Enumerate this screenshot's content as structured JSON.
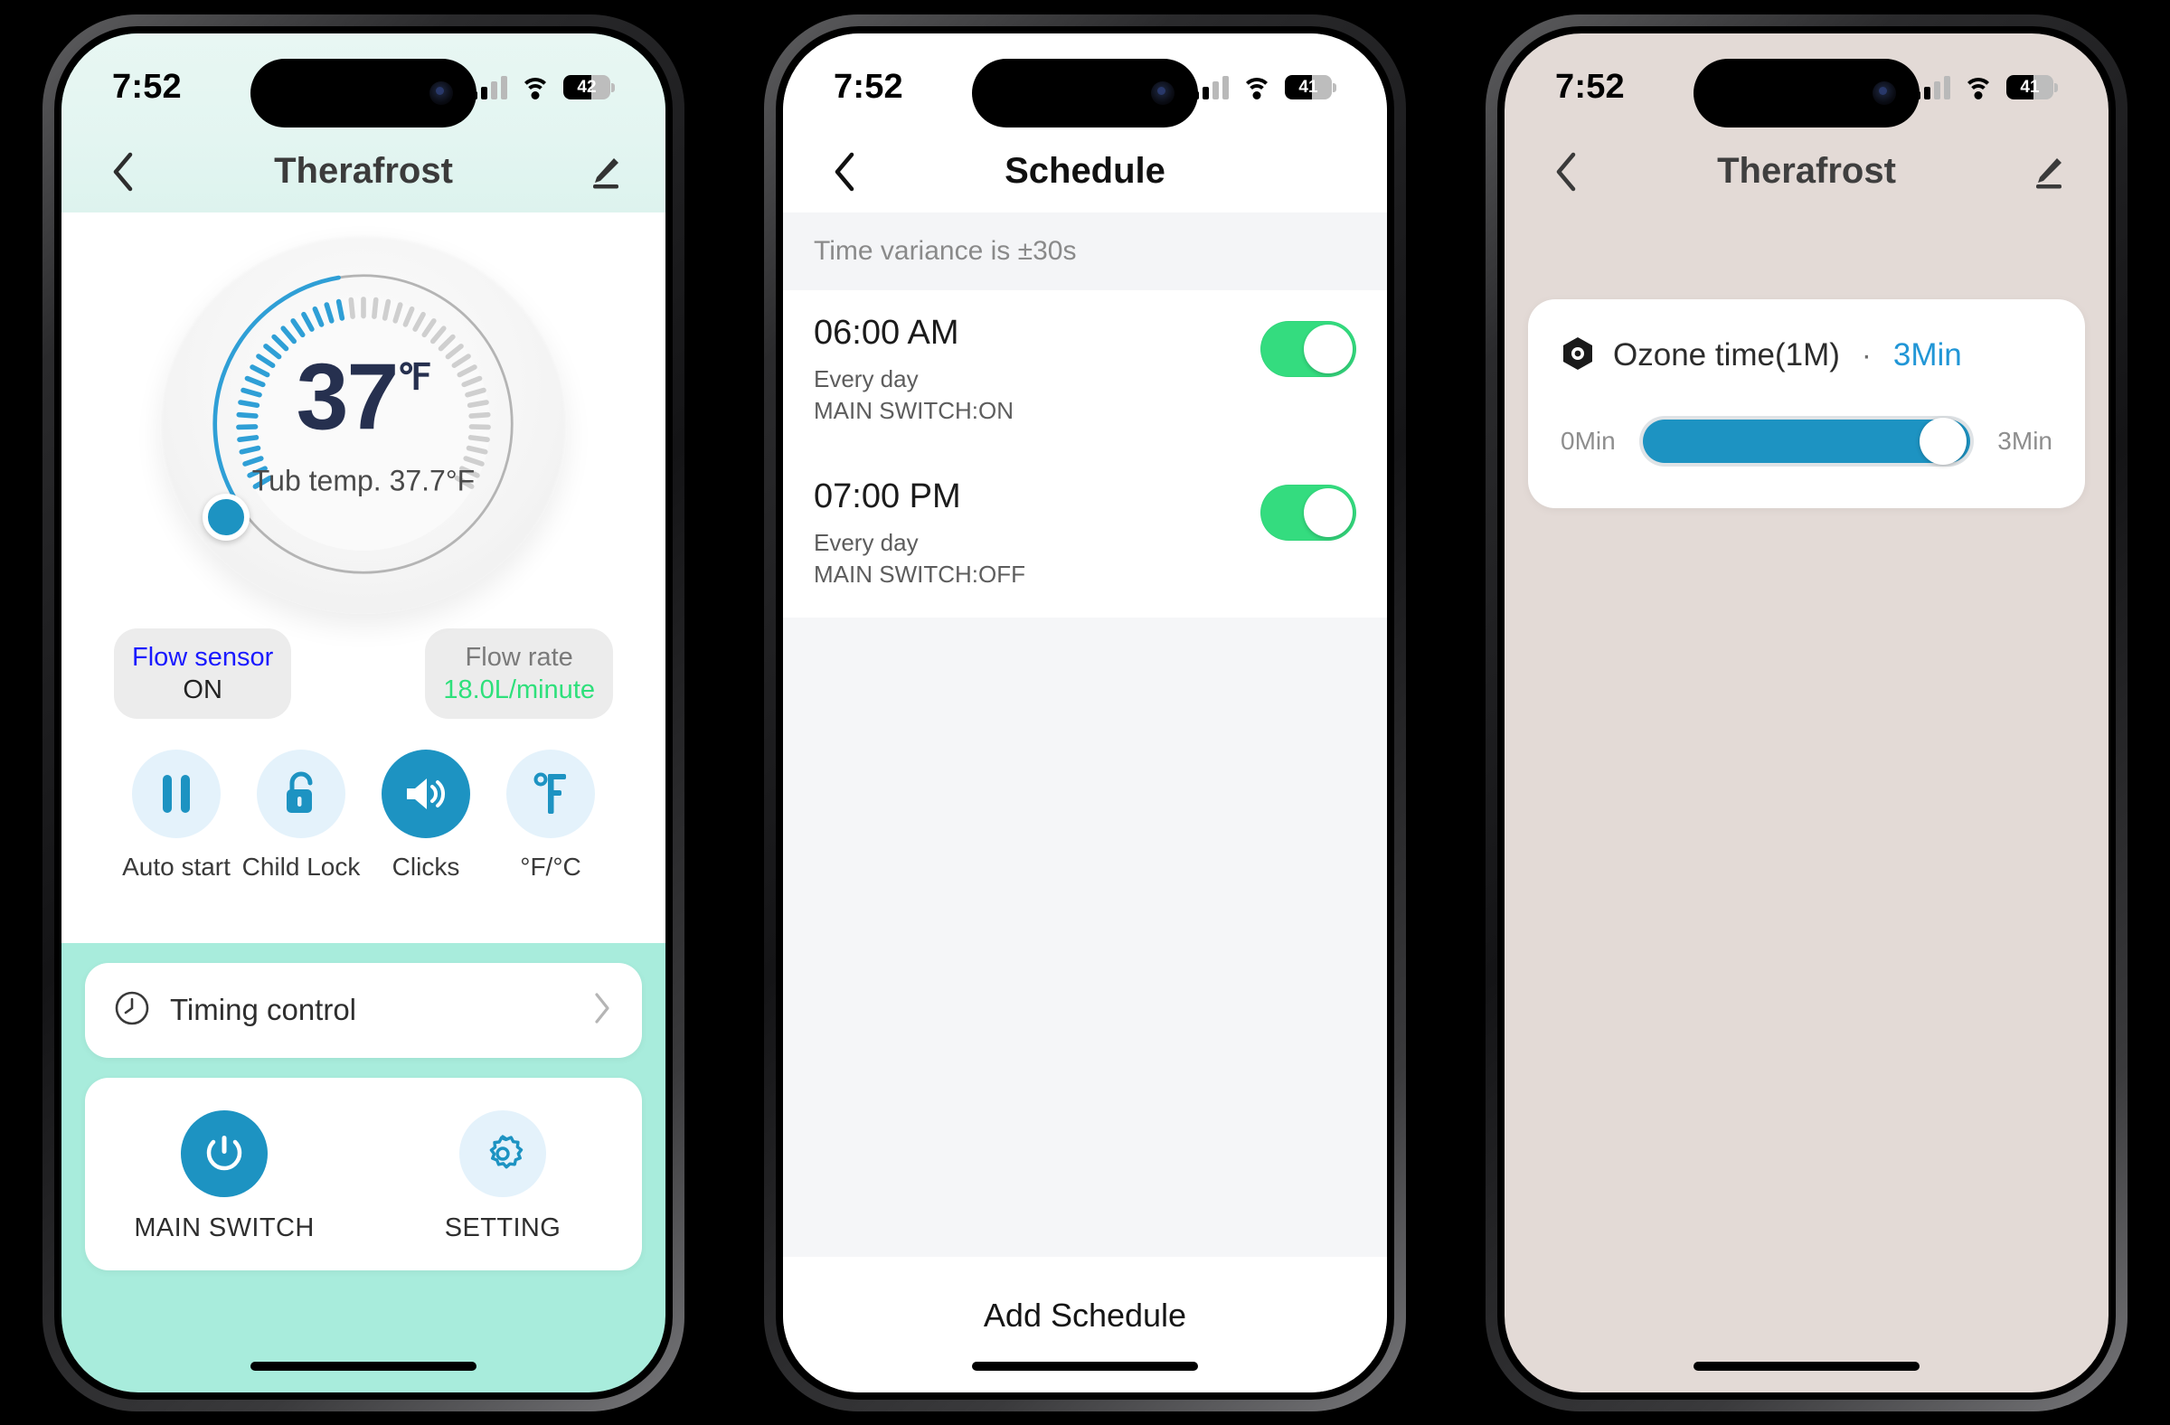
{
  "phones": [
    {
      "id": "home",
      "status": {
        "time": "7:52",
        "battery": "42",
        "battery_pct": 60,
        "signal_icon": "cellular-bars-icon",
        "wifi_icon": "wifi-icon",
        "battery_icon": "battery-icon"
      },
      "nav": {
        "back_icon": "chevron-left-icon",
        "title": "Therafrost",
        "edit_icon": "pencil-edit-icon"
      },
      "dial": {
        "temp": "37",
        "unit": "℉",
        "subtitle": "Tub temp. 37.7°F",
        "handle_icon": "dial-handle",
        "arc_color": "#2f9fd6",
        "value_color": "#26304f"
      },
      "chips": [
        {
          "name": "flow-sensor",
          "line1": "Flow sensor",
          "line2": "ON",
          "line1_color": "#1a1aff",
          "line2_color": "#222222"
        },
        {
          "name": "flow-rate",
          "line1": "Flow rate",
          "line2": "18.0L/minute",
          "line1_color": "#7a7a7a",
          "line2_color": "#2ee07b"
        }
      ],
      "icons": [
        {
          "label": "Auto start",
          "icon": "pause-icon",
          "active": false
        },
        {
          "label": "Child Lock",
          "icon": "unlocked-padlock-icon",
          "active": false
        },
        {
          "label": "Clicks",
          "icon": "speaker-volume-icon",
          "active": true
        },
        {
          "label": "°F/°C",
          "icon": "fahrenheit-icon",
          "active": false
        }
      ],
      "timing": {
        "label": "Timing control",
        "icon": "clock-icon",
        "chevron": "chevron-right-icon"
      },
      "switches": [
        {
          "label": "MAIN SWITCH",
          "icon": "power-icon",
          "active": true
        },
        {
          "label": "SETTING",
          "icon": "gear-icon",
          "active": false
        }
      ],
      "accent": "#1d93c2",
      "page_bg": "#a8ecdc"
    },
    {
      "id": "schedule",
      "status": {
        "time": "7:52",
        "battery": "41",
        "battery_pct": 58
      },
      "nav": {
        "back_icon": "chevron-left-icon",
        "title": "Schedule"
      },
      "variance": "Time variance is  ±30s",
      "schedules": [
        {
          "time": "06:00 AM",
          "repeat": "Every day",
          "action": "MAIN SWITCH:ON",
          "enabled": true
        },
        {
          "time": "07:00 PM",
          "repeat": "Every day",
          "action": "MAIN SWITCH:OFF",
          "enabled": true
        }
      ],
      "add_label": "Add Schedule",
      "toggle_on_color": "#34dc7f"
    },
    {
      "id": "ozone",
      "status": {
        "time": "7:52",
        "battery": "41",
        "battery_pct": 58
      },
      "nav": {
        "back_icon": "chevron-left-icon",
        "title": "Therafrost",
        "edit_icon": "pencil-edit-icon"
      },
      "ozone": {
        "icon": "ozone-hex-icon",
        "title": "Ozone time(1M)",
        "separator": "·",
        "value": "3Min",
        "min_label": "0Min",
        "max_label": "3Min",
        "slider_pct": 100,
        "value_color": "#2196d6",
        "fill_color": "#1d93c2"
      },
      "page_bg": "#e3dad6"
    }
  ]
}
